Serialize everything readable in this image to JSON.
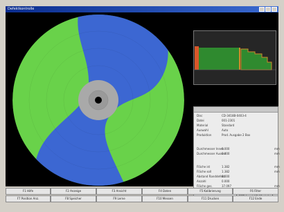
{
  "window": {
    "title": "Defektkontrolle"
  },
  "info_panel": {
    "rows_top": [
      {
        "label": "Disc",
        "value": "CD-3418B-0403-4"
      },
      {
        "label": "Datei",
        "value": "001-2301"
      },
      {
        "label": "Material",
        "value": "Standard"
      },
      {
        "label": "Auswahl",
        "value": "Auto"
      },
      {
        "label": "Produktion",
        "value": "Prod. Ausgabe 2 Box"
      }
    ],
    "rows_mid": [
      {
        "label": "Durchmesser Innen",
        "value": "0.000",
        "unit": "mm"
      },
      {
        "label": "Durchmesser Aussen",
        "value": "0.000",
        "unit": "mm"
      }
    ],
    "rows_low": [
      {
        "label": "Fläche ist",
        "value": "1.382",
        "unit": "mm"
      },
      {
        "label": "Fläche soll",
        "value": "1.382",
        "unit": "mm"
      },
      {
        "label": "Abstand Randdefekt",
        "value": "0.000",
        "unit": ""
      },
      {
        "label": "Anzahl",
        "value": "0.000",
        "unit": ""
      },
      {
        "label": "Fläche ges.",
        "value": "37.097",
        "unit": "mm"
      }
    ],
    "detail_button": "DEF Anzahl/Größe Info"
  },
  "function_keys": {
    "row1": [
      "F1 Hilfe",
      "F2 Anzeige",
      "F3 Ansicht",
      "F4 Daten",
      "F5 Kalibrierung",
      "F6 Filter"
    ],
    "row2": [
      "F7 Position Anz.",
      "F8 Speicher",
      "F9 Lerne",
      "F10 Messen",
      "F11 Drucken",
      "F12 Ende"
    ]
  },
  "colors": {
    "disc_green": "#69d24a",
    "disc_blue": "#3c67d2",
    "hub": "#a9a9a9",
    "background": "#000000"
  },
  "icons": [
    "minimize-icon",
    "maximize-icon",
    "close-icon"
  ]
}
